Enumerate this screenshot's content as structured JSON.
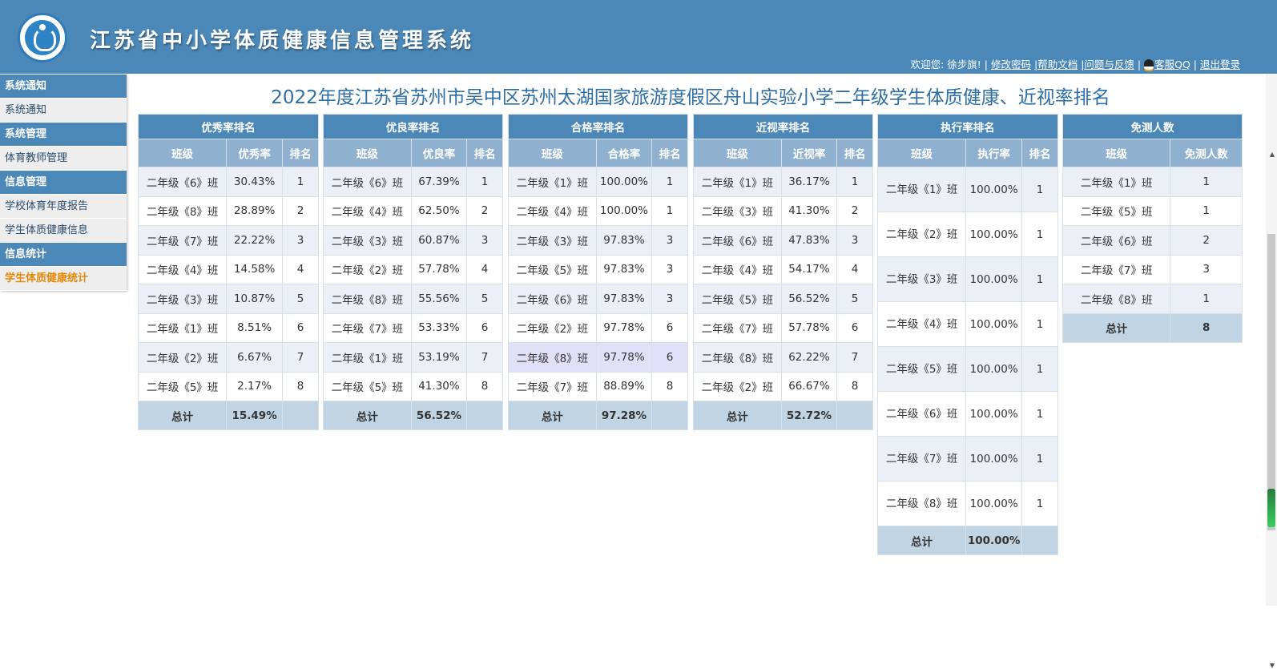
{
  "header": {
    "title": "江苏省中小学体质健康信息管理系统",
    "welcome": "欢迎您: 徐步旗! |",
    "links": [
      "修改密码",
      "|帮助文档",
      "|问题与反馈",
      "|",
      "客服QQ",
      "|",
      "退出登录"
    ]
  },
  "sidebar": {
    "sections": [
      {
        "title": "系统通知",
        "items": [
          "系统通知"
        ]
      },
      {
        "title": "系统管理",
        "items": [
          "体育教师管理"
        ]
      },
      {
        "title": "信息管理",
        "items": [
          "学校体育年度报告",
          "学生体质健康信息"
        ]
      },
      {
        "title": "信息统计",
        "items": [
          "学生体质健康统计"
        ]
      }
    ],
    "active_item": "学生体质健康统计"
  },
  "page": {
    "heading": "2022年度江苏省苏州市吴中区苏州太湖国家旅游度假区舟山实验小学二年级学生体质健康、近视率排名"
  },
  "tables": {
    "excellent": {
      "title": "优秀率排名",
      "cols": [
        "班级",
        "优秀率",
        "排名"
      ],
      "rows": [
        [
          "二年级《6》班",
          "30.43%",
          "1"
        ],
        [
          "二年级《8》班",
          "28.89%",
          "2"
        ],
        [
          "二年级《7》班",
          "22.22%",
          "3"
        ],
        [
          "二年级《4》班",
          "14.58%",
          "4"
        ],
        [
          "二年级《3》班",
          "10.87%",
          "5"
        ],
        [
          "二年级《1》班",
          "8.51%",
          "6"
        ],
        [
          "二年级《2》班",
          "6.67%",
          "7"
        ],
        [
          "二年级《5》班",
          "2.17%",
          "8"
        ]
      ],
      "total": [
        "总计",
        "15.49%",
        ""
      ]
    },
    "good": {
      "title": "优良率排名",
      "cols": [
        "班级",
        "优良率",
        "排名"
      ],
      "rows": [
        [
          "二年级《6》班",
          "67.39%",
          "1"
        ],
        [
          "二年级《4》班",
          "62.50%",
          "2"
        ],
        [
          "二年级《3》班",
          "60.87%",
          "3"
        ],
        [
          "二年级《2》班",
          "57.78%",
          "4"
        ],
        [
          "二年级《8》班",
          "55.56%",
          "5"
        ],
        [
          "二年级《7》班",
          "53.33%",
          "6"
        ],
        [
          "二年级《1》班",
          "53.19%",
          "7"
        ],
        [
          "二年级《5》班",
          "41.30%",
          "8"
        ]
      ],
      "total": [
        "总计",
        "56.52%",
        ""
      ]
    },
    "pass": {
      "title": "合格率排名",
      "cols": [
        "班级",
        "合格率",
        "排名"
      ],
      "rows": [
        [
          "二年级《1》班",
          "100.00%",
          "1"
        ],
        [
          "二年级《4》班",
          "100.00%",
          "1"
        ],
        [
          "二年级《3》班",
          "97.83%",
          "3"
        ],
        [
          "二年级《5》班",
          "97.83%",
          "3"
        ],
        [
          "二年级《6》班",
          "97.83%",
          "3"
        ],
        [
          "二年级《2》班",
          "97.78%",
          "6"
        ],
        [
          "二年级《8》班",
          "97.78%",
          "6"
        ],
        [
          "二年级《7》班",
          "88.89%",
          "8"
        ]
      ],
      "total": [
        "总计",
        "97.28%",
        ""
      ]
    },
    "myopia": {
      "title": "近视率排名",
      "cols": [
        "班级",
        "近视率",
        "排名"
      ],
      "rows": [
        [
          "二年级《1》班",
          "36.17%",
          "1"
        ],
        [
          "二年级《3》班",
          "41.30%",
          "2"
        ],
        [
          "二年级《6》班",
          "47.83%",
          "3"
        ],
        [
          "二年级《4》班",
          "54.17%",
          "4"
        ],
        [
          "二年级《5》班",
          "56.52%",
          "5"
        ],
        [
          "二年级《7》班",
          "57.78%",
          "6"
        ],
        [
          "二年级《8》班",
          "62.22%",
          "7"
        ],
        [
          "二年级《2》班",
          "66.67%",
          "8"
        ]
      ],
      "total": [
        "总计",
        "52.72%",
        ""
      ]
    },
    "execution": {
      "title": "执行率排名",
      "cols": [
        "班级",
        "执行率",
        "排名"
      ],
      "rows": [
        [
          "二年级《1》班",
          "100.00%",
          "1"
        ],
        [
          "二年级《2》班",
          "100.00%",
          "1"
        ],
        [
          "二年级《3》班",
          "100.00%",
          "1"
        ],
        [
          "二年级《4》班",
          "100.00%",
          "1"
        ],
        [
          "二年级《5》班",
          "100.00%",
          "1"
        ],
        [
          "二年级《6》班",
          "100.00%",
          "1"
        ],
        [
          "二年级《7》班",
          "100.00%",
          "1"
        ],
        [
          "二年级《8》班",
          "100.00%",
          "1"
        ]
      ],
      "total": [
        "总计",
        "100.00%",
        ""
      ]
    },
    "exempt": {
      "title": "免测人数",
      "cols": [
        "班级",
        "免测人数"
      ],
      "rows": [
        [
          "二年级《1》班",
          "1"
        ],
        [
          "二年级《5》班",
          "1"
        ],
        [
          "二年级《6》班",
          "2"
        ],
        [
          "二年级《7》班",
          "3"
        ],
        [
          "二年级《8》班",
          "1"
        ]
      ],
      "total": [
        "总计",
        "8"
      ]
    }
  }
}
